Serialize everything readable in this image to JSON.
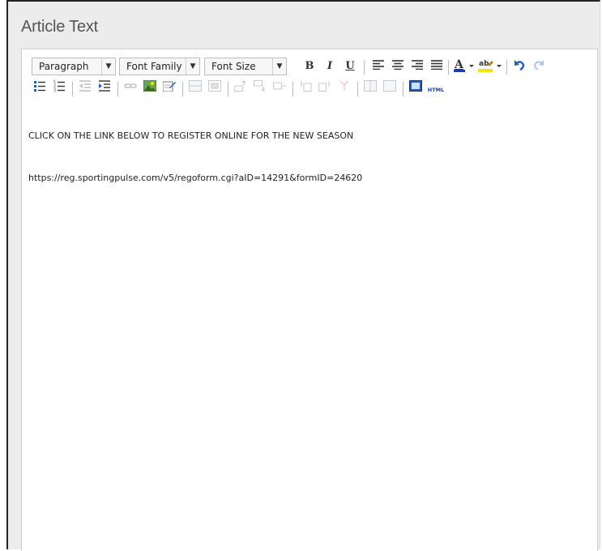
{
  "header": {
    "title": "Article Text"
  },
  "toolbar": {
    "format_select": "Paragraph",
    "font_family_select": "Font Family",
    "font_size_select": "Font Size",
    "bold": "B",
    "italic": "I",
    "underline": "U",
    "html_label": "HTML"
  },
  "content": {
    "line1": "CLICK ON THE LINK BELOW TO REGISTER ONLINE FOR THE NEW SEASON",
    "line2": "https://reg.sportingpulse.com/v5/regoform.cgi?aID=14291&formID=24620"
  },
  "colors": {
    "text_color": "#1f3ea8",
    "highlight_color": "#f5e400",
    "undo": "#1f5cc4"
  }
}
